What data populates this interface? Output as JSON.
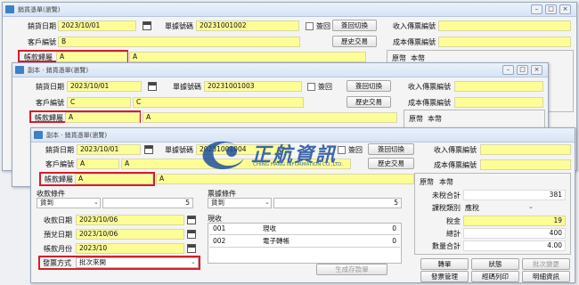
{
  "window1": {
    "title": "銷貨憑單(瀏覽)",
    "sale_date_label": "銷貨日期",
    "sale_date": "2023/10/01",
    "doc_no_label": "單據號碼",
    "doc_no": "20231001002",
    "void_label": "簽回",
    "switch_btn": "簽回切換",
    "customer_no_label": "客戶編號",
    "customer_no": "B",
    "history_btn": "歷史交易",
    "account_label": "帳款歸屬",
    "account_code": "A",
    "account_name": "A",
    "income_label": "收入傳票編號",
    "cost_label": "成本傳票編號",
    "currency_label": "原幣",
    "currency": "本幣"
  },
  "window2": {
    "title": "副本 · 銷貨憑單(瀏覽)",
    "sale_date_label": "銷貨日期",
    "sale_date": "2023/10/01",
    "doc_no_label": "單據號碼",
    "doc_no": "20231001003",
    "void_label": "簽回",
    "switch_btn": "簽回切換",
    "customer_no_label": "客戶編號",
    "customer_no": "C",
    "customer_name": "C",
    "history_btn": "歷史交易",
    "account_label": "帳款歸屬",
    "account_code": "A",
    "account_name": "A",
    "income_label": "收入傳票編號",
    "cost_label": "成本傳票編號",
    "currency_label": "原幣",
    "currency": "本幣"
  },
  "window3": {
    "title": "副本 · 銷貨憑單(瀏覽)",
    "sale_date_label": "銷貨日期",
    "sale_date": "2023/10/01",
    "doc_no_label": "單據號碼",
    "doc_no": "20231001004",
    "void_label": "簽回",
    "switch_btn": "簽回切換",
    "customer_no_label": "客戶編號",
    "customer_no": "A",
    "customer_name": "A",
    "history_btn": "歷史交易",
    "account_label": "帳款歸屬",
    "account_code": "A",
    "account_name": "A",
    "income_label": "收入傳票編號",
    "cost_label": "成本傳票編號",
    "collect": {
      "group_label": "收款條件",
      "term": "貨到",
      "days": "5",
      "collect_date_label": "收款日期",
      "collect_date": "2023/10/06",
      "due_date_label": "預兌日期",
      "due_date": "2023/10/06",
      "account_month_label": "帳款月份",
      "account_month": "2023/10",
      "invoice_method_label": "發票方式",
      "invoice_method": "批次來開"
    },
    "invoice": {
      "group_label": "票據條件",
      "term": "貨到",
      "days": "5"
    },
    "receipt": {
      "group_label": "現收",
      "rows": [
        {
          "no": "001",
          "name": "現收",
          "amount": "0"
        },
        {
          "no": "002",
          "name": "電子轉帳",
          "amount": "0"
        }
      ],
      "gen_btn": "生成存款單"
    },
    "summary": {
      "currency_label": "原幣",
      "currency": "本幣",
      "untaxed_label": "未稅合計",
      "untaxed": "381",
      "tax_type_label": "課稅類別",
      "tax_type": "應稅",
      "tax_label": "稅金",
      "tax": "19",
      "total_label": "總計",
      "total": "400",
      "qty_label": "數量合計",
      "qty": "4.00"
    },
    "buttons": {
      "transfer": "轉單",
      "status": "狀態",
      "batch_change": "批次變更",
      "invoice_mgmt": "發票管理",
      "print": "經碼列印",
      "detail": "明細資訊"
    }
  },
  "watermark": {
    "brand": "正航資訊",
    "brand_en": "CHING HANG INFORMATION CO.,LTD."
  },
  "colors": {
    "highlight": "#d21f2a",
    "field": "#fdfd96",
    "logo_blue": "#1e4f9e"
  }
}
